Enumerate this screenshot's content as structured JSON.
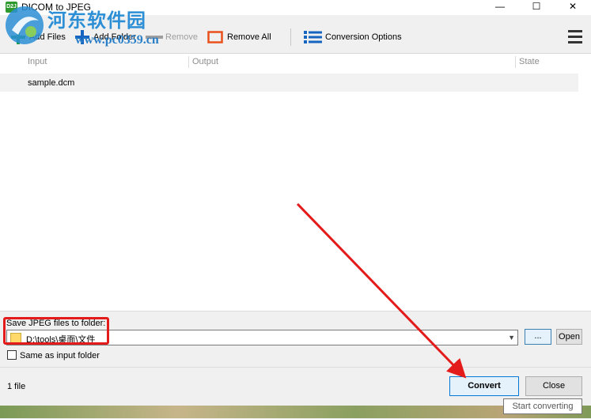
{
  "window": {
    "title": "DICOM to JPEG",
    "app_icon_text": "D2J",
    "minimize_glyph": "—",
    "maximize_glyph": "☐",
    "close_glyph": "✕"
  },
  "watermark": {
    "site_name": "河东软件园",
    "site_url": "www.pc0359.cn"
  },
  "toolbar": {
    "add_files": "Add Files",
    "add_folder": "Add Folder",
    "remove": "Remove",
    "remove_all": "Remove All",
    "conversion_options": "Conversion Options",
    "add_folder_icon": "plus-icon",
    "remove_icon": "minus-icon",
    "remove_all_icon": "square-outline-icon",
    "options_icon": "list-icon",
    "menu_icon": "hamburger-icon"
  },
  "file_list": {
    "columns": [
      "Input",
      "Output",
      "State"
    ],
    "rows": [
      {
        "input": "sample.dcm",
        "output": "",
        "state": ""
      }
    ]
  },
  "output": {
    "save_label": "Save JPEG files to folder:",
    "path": "D:\\tools\\桌面\\文件",
    "browse_label": "...",
    "open_label": "Open",
    "same_as_input_label": "Same as input folder",
    "same_as_input_checked": false
  },
  "status": {
    "file_count": "1 file",
    "convert_label": "Convert",
    "close_label": "Close",
    "tooltip": "Start converting"
  },
  "colors": {
    "annotation_red": "#e31b1b",
    "accent_blue": "#0078d7",
    "watermark_blue": "#2c8fd6"
  }
}
